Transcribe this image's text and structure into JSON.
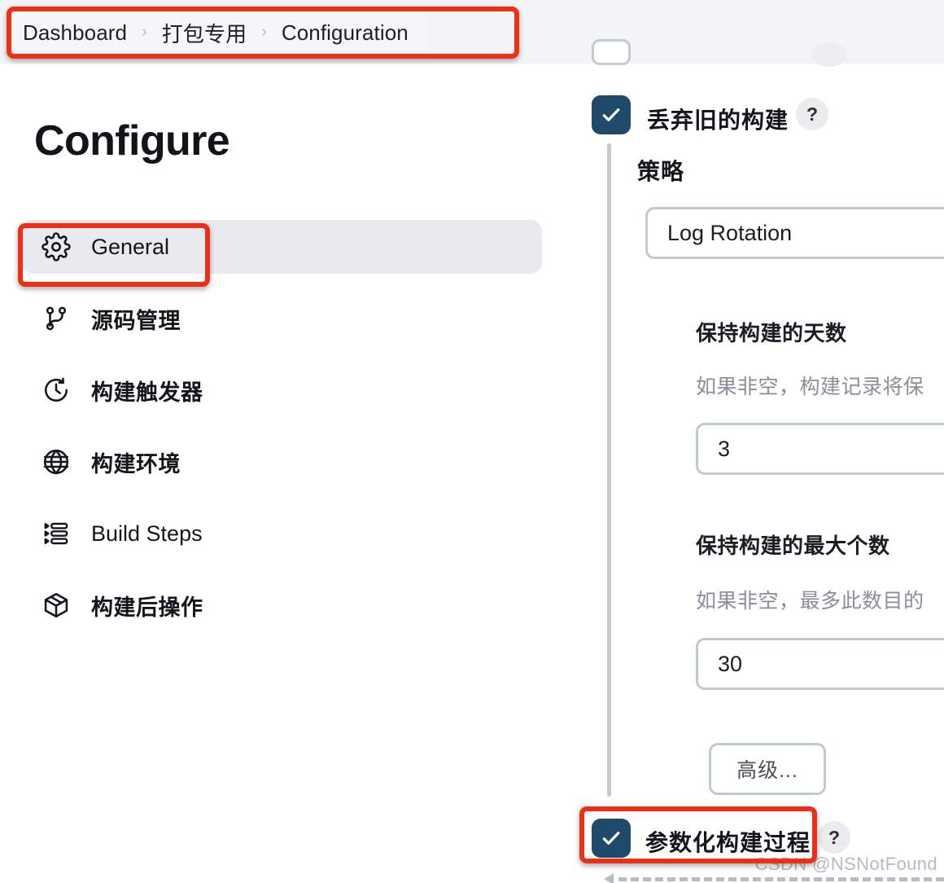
{
  "breadcrumb": {
    "separator": "›",
    "items": [
      {
        "label": "Dashboard"
      },
      {
        "label": "打包专用"
      },
      {
        "label": "Configuration"
      }
    ]
  },
  "page": {
    "title": "Configure"
  },
  "sidebar": {
    "items": [
      {
        "label": "General",
        "icon": "gear-icon",
        "active": true
      },
      {
        "label": "源码管理",
        "icon": "git-branch-icon",
        "active": false
      },
      {
        "label": "构建触发器",
        "icon": "clock-icon",
        "active": false
      },
      {
        "label": "构建环境",
        "icon": "globe-icon",
        "active": false
      },
      {
        "label": "Build Steps",
        "icon": "list-steps-icon",
        "active": false
      },
      {
        "label": "构建后操作",
        "icon": "package-icon",
        "active": false
      }
    ]
  },
  "main": {
    "discard_builds": {
      "label": "丢弃旧的构建",
      "checked": true,
      "help": "?"
    },
    "strategy": {
      "label": "策略",
      "value": "Log Rotation"
    },
    "days_to_keep": {
      "label": "保持构建的天数",
      "description": "如果非空，构建记录将保",
      "value": "3"
    },
    "max_builds_to_keep": {
      "label": "保持构建的最大个数",
      "description": "如果非空，最多此数目的",
      "value": "30"
    },
    "advanced_button": {
      "label": "高级..."
    },
    "parameterized_build": {
      "label": "参数化构建过程",
      "checked": true,
      "help": "?"
    }
  },
  "watermark": {
    "text": "CSDN @NSNotFound"
  },
  "colors": {
    "annotation": "#ec2f17",
    "checkbox": "#1f4a6b",
    "header_band": "#f3f4f6",
    "active_nav": "#e9eaef",
    "border": "#c2cad1",
    "muted_text": "#8b8d9b"
  }
}
